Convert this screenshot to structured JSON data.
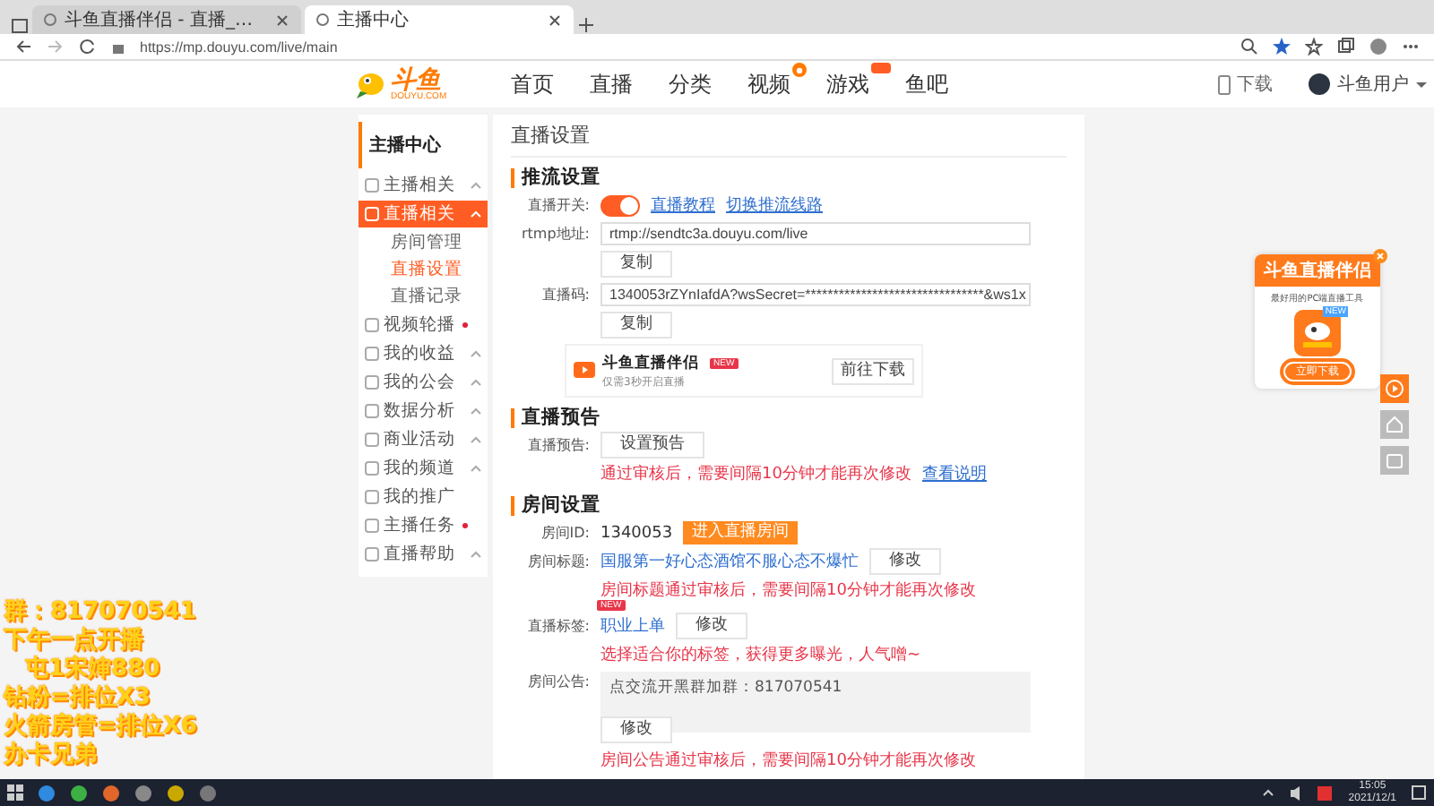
{
  "browser": {
    "tabs": [
      {
        "title": "斗鱼直播伴侣 - 直播_…",
        "selected": false
      },
      {
        "title": "主播中心",
        "selected": true
      }
    ],
    "url": "https://mp.douyu.com/live/main"
  },
  "header": {
    "logo": "斗鱼",
    "logo_sub": "DOUYU.COM",
    "nav": [
      {
        "label": "首页",
        "kind": "plain"
      },
      {
        "label": "直播",
        "kind": "plain"
      },
      {
        "label": "分类",
        "kind": "plain"
      },
      {
        "label": "视频",
        "kind": "dotted"
      },
      {
        "label": "游戏",
        "kind": "tagged"
      },
      {
        "label": "鱼吧",
        "kind": "plain"
      }
    ],
    "download": "下载",
    "user": "斗鱼用户"
  },
  "sidebar": {
    "title": "主播中心",
    "items": [
      {
        "label": "主播相关",
        "kind": "group",
        "selected": false,
        "new_dot": false
      },
      {
        "label": "直播相关",
        "kind": "group",
        "selected": true,
        "new_dot": false,
        "children": [
          {
            "label": "房间管理",
            "selected": false
          },
          {
            "label": "直播设置",
            "selected": true
          },
          {
            "label": "直播记录",
            "selected": false
          }
        ]
      },
      {
        "label": "视频轮播",
        "kind": "link",
        "selected": false,
        "new_dot": true
      },
      {
        "label": "我的收益",
        "kind": "group",
        "selected": false,
        "new_dot": false
      },
      {
        "label": "我的公会",
        "kind": "group",
        "selected": false,
        "new_dot": false
      },
      {
        "label": "数据分析",
        "kind": "group",
        "selected": false,
        "new_dot": false
      },
      {
        "label": "商业活动",
        "kind": "group",
        "selected": false,
        "new_dot": false
      },
      {
        "label": "我的频道",
        "kind": "group",
        "selected": false,
        "new_dot": false
      },
      {
        "label": "我的推广",
        "kind": "link",
        "selected": false,
        "new_dot": false
      },
      {
        "label": "主播任务",
        "kind": "link",
        "selected": false,
        "new_dot": true
      },
      {
        "label": "直播帮助",
        "kind": "group",
        "selected": false,
        "new_dot": false
      }
    ]
  },
  "panel": {
    "title": "直播设置",
    "push": {
      "heading": "推流设置",
      "switch_label": "直播开关:",
      "switch_on": true,
      "links": [
        "直播教程",
        "切换推流线路"
      ],
      "rtmp_label": "rtmp地址:",
      "rtmp_value": "rtmp://sendtc3a.douyu.com/live",
      "rtmp_copy": "复制",
      "code_label": "直播码:",
      "code_value": "1340053rZYnIafdA?wsSecret=********************************&ws1x",
      "code_copy": "复制",
      "promo": {
        "name": "斗鱼直播伴侣",
        "badge": "NEW",
        "desc": "仅需3秒开启直播",
        "button": "前往下载"
      }
    },
    "notice": {
      "heading": "直播预告",
      "label": "直播预告:",
      "button": "设置预告",
      "hint": "通过审核后，需要间隔10分钟才能再次修改",
      "link": "查看说明"
    },
    "room": {
      "heading": "房间设置",
      "id_label": "房间ID:",
      "id": "1340053",
      "enter": "进入直播房间",
      "title_label": "房间标题:",
      "title": "国服第一好心态酒馆不服心态不爆忙",
      "title_edit": "修改",
      "title_hint": "房间标题通过审核后，需要间隔10分钟才能再次修改",
      "tag_label": "直播标签:",
      "tag_badge": "NEW",
      "tag": "职业上单",
      "tag_edit": "修改",
      "tag_hint": "选择适合你的标签，获得更多曝光，人气噌~",
      "notice_label": "房间公告:",
      "notice_text": "点交流开黑群加群：817070541",
      "notice_edit": "修改",
      "notice_hint": "房间公告通过审核后，需要间隔10分钟才能再次修改"
    }
  },
  "promo_widget": {
    "title": "斗鱼直播伴侣",
    "desc": "最好用的PC端直播工具",
    "badge": "NEW",
    "button": "立即下载"
  },
  "overlay": {
    "lines": [
      "群：817070541",
      "下午一点开播",
      "屯1宋婶880",
      "钻粉=排位X3",
      "火箭房管=排位X6",
      "办卡兄弟"
    ]
  },
  "taskbar": {
    "time": "15:05",
    "date": "2021/12/1"
  }
}
